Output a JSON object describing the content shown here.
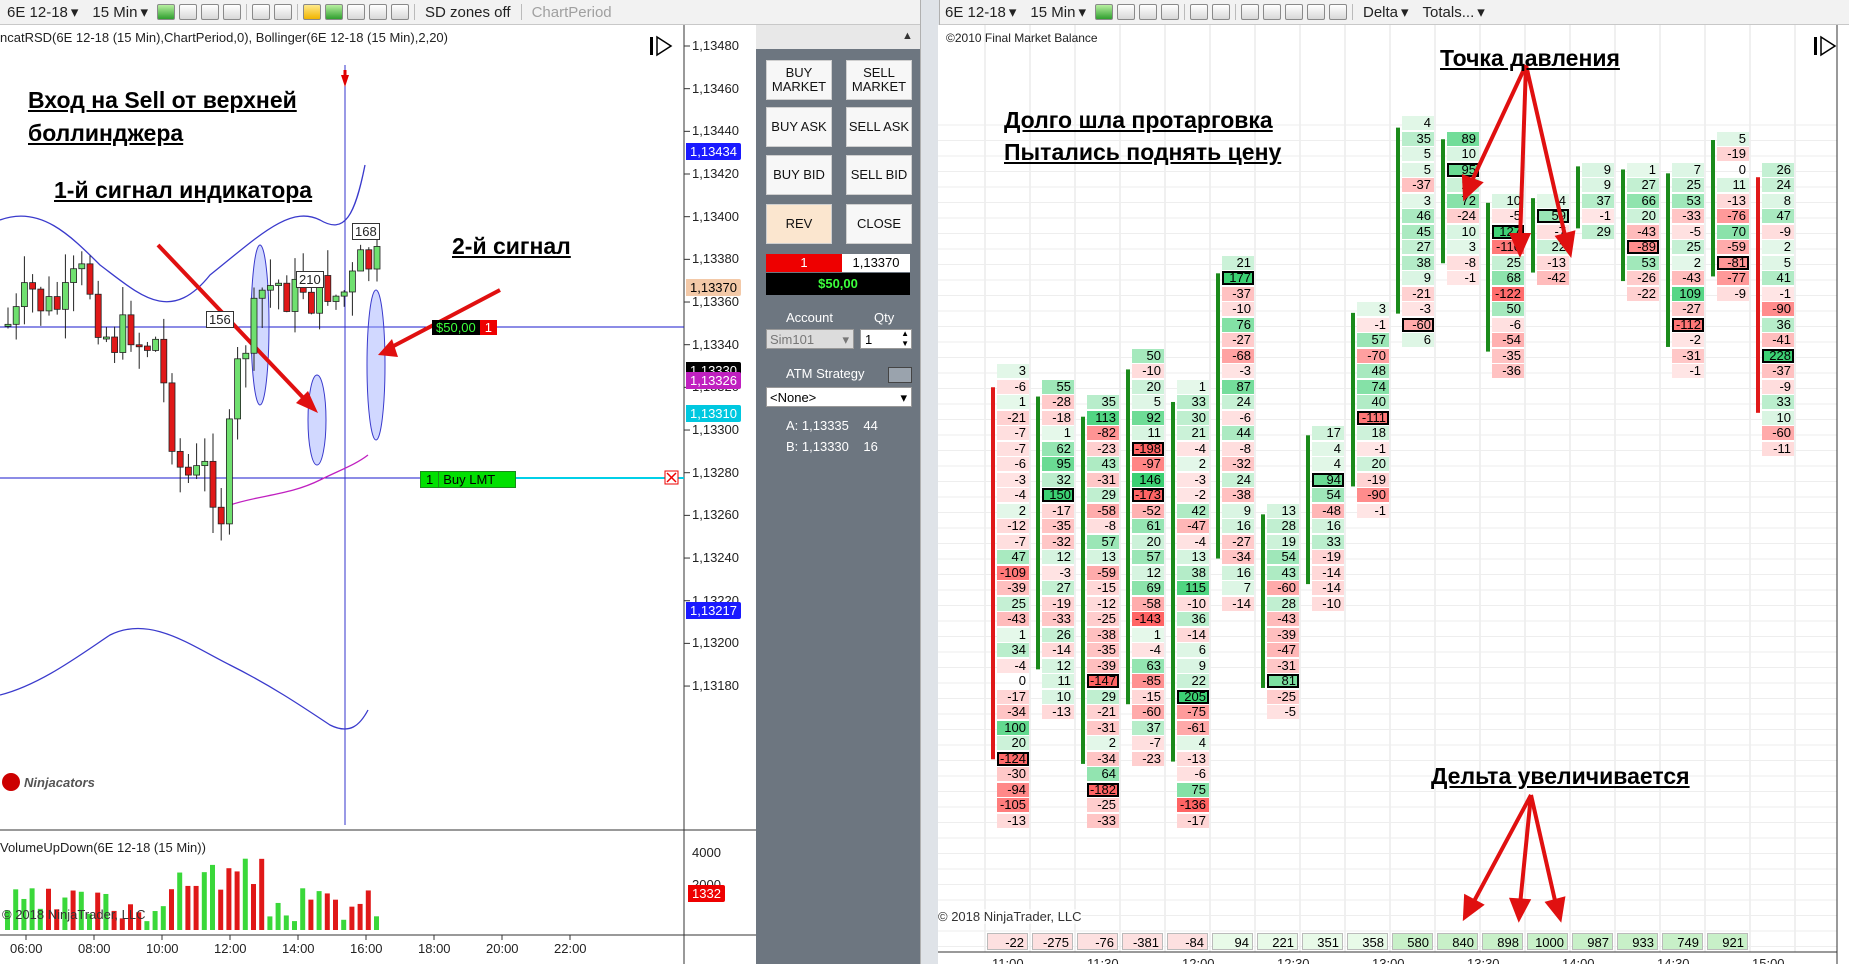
{
  "left_toolbar": {
    "instrument": "6E 12-18",
    "interval": "15 Min",
    "sd_zones": "SD zones off",
    "chart_period": "ChartPeriod"
  },
  "right_toolbar": {
    "instrument": "6E 12-18",
    "interval": "15 Min",
    "mode": "Delta",
    "totals": "Totals..."
  },
  "left_chart": {
    "indicator_label": "ncatRSD(6E 12-18 (15 Min),ChartPeriod,0), Bollinger(6E 12-18 (15 Min),2,20)",
    "price_ticks": [
      "1,13480",
      "1,13460",
      "1,13440",
      "1,13420",
      "1,13400",
      "1,13380",
      "1,13360",
      "1,13340",
      "1,13320",
      "1,13300",
      "1,13280",
      "1,13260",
      "1,13240",
      "1,13220",
      "1,13200",
      "1,13180"
    ],
    "price_flags": [
      {
        "text": "1,13434",
        "color": "#1a1aff"
      },
      {
        "text": "1,13370",
        "color": "#f3c9a8"
      },
      {
        "text": "1,13330",
        "color": "#000000"
      },
      {
        "text": "1,13326",
        "color": "#c020c0"
      },
      {
        "text": "1,13310",
        "color": "#00c8e0"
      },
      {
        "text": "1,13217",
        "color": "#1a1aff"
      }
    ],
    "candle_tags": [
      "156",
      "210",
      "168"
    ],
    "position_badge": {
      "value": "$50,00",
      "qty": "1"
    },
    "order_badge": {
      "qty": "1",
      "label": "Buy LMT"
    },
    "watermark": "Ninjacators",
    "annotations": {
      "entry_line1": "Вход на Sell от верхней",
      "entry_line2": "боллинджера",
      "signal1": "1-й сигнал индикатора",
      "signal2": "2-й сигнал"
    },
    "volume_label": "VolumeUpDown(6E 12-18 (15 Min))",
    "volume_ticks": [
      "4000",
      "2000"
    ],
    "volume_flag": "1332",
    "copyright": "© 2018 NinjaTrader, LLC",
    "time_ticks": [
      "06:00",
      "08:00",
      "10:00",
      "12:00",
      "14:00",
      "16:00",
      "18:00",
      "20:00",
      "22:00"
    ]
  },
  "order_panel": {
    "buy_market": "BUY MARKET",
    "sell_market": "SELL MARKET",
    "buy_ask": "BUY ASK",
    "sell_ask": "SELL ASK",
    "buy_bid": "BUY BID",
    "sell_bid": "SELL BID",
    "rev": "REV",
    "close": "CLOSE",
    "position_qty": "1",
    "position_price": "1,13370",
    "pnl": "$50,00",
    "account_label": "Account",
    "qty_label": "Qty",
    "account_value": "Sim101",
    "qty_value": "1",
    "atm_label": "ATM Strategy",
    "atm_value": "<None>",
    "ask_line": "A: 1,13335    44",
    "bid_line": "B: 1,13330    16"
  },
  "right_chart": {
    "header": "©2010 Final Market Balance",
    "annotations": {
      "pressure": "Точка давления",
      "line1": "Долго шла протарговка",
      "line2": "Пытались поднять цену",
      "delta": "Дельта увеличивается"
    },
    "time_ticks": [
      "11:00",
      "11:30",
      "12:00",
      "12:30",
      "13:00",
      "13:30",
      "14:00",
      "14:30",
      "15:00"
    ],
    "totals": [
      "-22",
      "-275",
      "-76",
      "-381",
      "-84",
      "94",
      "221",
      "351",
      "358",
      "580",
      "840",
      "898",
      "1000",
      "987",
      "933",
      "749",
      "921"
    ],
    "copyright": "© 2018 NinjaTrader, LLC",
    "columns": [
      {
        "start": 0,
        "values": [
          "3",
          "-6",
          "1",
          "-21",
          "-7",
          "-7",
          "-6",
          "-3",
          "-4",
          "2",
          "-12",
          "-7",
          "47",
          "-109",
          "-39",
          "25",
          "-43",
          "1",
          "34",
          "-4",
          "0",
          "-17",
          "-34",
          "100",
          "20",
          "-124",
          "-30",
          "-94",
          "-105",
          "-13"
        ],
        "boxed": [
          25
        ]
      },
      {
        "start": 1,
        "values": [
          "55",
          "-28",
          "-18",
          "1",
          "62",
          "95",
          "32",
          "150",
          "-17",
          "-35",
          "-32",
          "12",
          "-3",
          "27",
          "-19",
          "-33",
          "26",
          "-14",
          "12",
          "11",
          "10",
          "-13"
        ],
        "boxed": [
          7
        ]
      },
      {
        "start": 2,
        "values": [
          "35",
          "113",
          "-82",
          "-23",
          "43",
          "-31",
          "29",
          "-58",
          "-8",
          "57",
          "13",
          "-59",
          "-15",
          "-12",
          "-25",
          "-38",
          "-35",
          "-39",
          "-147",
          "29",
          "-21",
          "-31",
          "2",
          "-34",
          "64",
          "-182",
          "-25",
          "-33"
        ],
        "boxed": [
          18,
          25
        ]
      },
      {
        "start": -1,
        "values": [
          "50",
          "-10",
          "20",
          "5",
          "92",
          "11",
          "-198",
          "-97",
          "146",
          "-173",
          "-52",
          "61",
          "20",
          "57",
          "12",
          "69",
          "-58",
          "-143",
          "1",
          "-4",
          "63",
          "-85",
          "-15",
          "-60",
          "37",
          "-7",
          "-23"
        ],
        "boxed": [
          6,
          9
        ]
      },
      {
        "start": 1,
        "values": [
          "1",
          "33",
          "30",
          "21",
          "-4",
          "2",
          "-3",
          "-2",
          "42",
          "-47",
          "-4",
          "13",
          "38",
          "115",
          "-10",
          "36",
          "-14",
          "6",
          "9",
          "22",
          "205",
          "-75",
          "-61",
          "4",
          "-13",
          "-6",
          "75",
          "-136",
          "-17"
        ],
        "boxed": [
          20
        ]
      },
      {
        "start": -7,
        "values": [
          "21",
          "177",
          "-37",
          "-10",
          "76",
          "-27",
          "-68",
          "-3",
          "87",
          "24",
          "-6",
          "44",
          "-8",
          "-32",
          "24",
          "-38",
          "9",
          "16",
          "-27",
          "-34",
          "16",
          "7",
          "-14"
        ],
        "boxed": [
          1
        ]
      },
      {
        "start": 9,
        "values": [
          "13",
          "28",
          "19",
          "54",
          "43",
          "-60",
          "28",
          "-43",
          "-39",
          "-47",
          "-31",
          "81",
          "-25",
          "-5"
        ],
        "boxed": [
          11
        ]
      },
      {
        "start": 4,
        "values": [
          "17",
          "4",
          "4",
          "94",
          "54",
          "-48",
          "16",
          "33",
          "-19",
          "-14",
          "-14",
          "-10"
        ],
        "boxed": [
          3
        ]
      },
      {
        "start": -4,
        "values": [
          "3",
          "-1",
          "57",
          "-70",
          "48",
          "74",
          "40",
          "-111",
          "18",
          "-1",
          "20",
          "-19",
          "-90",
          "-1"
        ],
        "boxed": [
          7
        ]
      },
      {
        "start": -16,
        "values": [
          "4",
          "35",
          "5",
          "5",
          "-37",
          "3",
          "46",
          "45",
          "27",
          "38",
          "9",
          "-21",
          "-3",
          "-60",
          "6"
        ],
        "boxed": [
          13
        ]
      },
      {
        "start": -15,
        "values": [
          "89",
          "10",
          "95",
          "21",
          "72",
          "-24",
          "10",
          "3",
          "-8",
          "-1"
        ],
        "boxed": [
          2
        ]
      },
      {
        "start": -11,
        "values": [
          "10",
          "-5",
          "127",
          "-110",
          "25",
          "68",
          "-122",
          "50",
          "-6",
          "-54",
          "-35",
          "-36"
        ],
        "boxed": [
          2
        ]
      },
      {
        "start": -11,
        "values": [
          "4",
          "59",
          "-7",
          "22",
          "-13",
          "-42"
        ],
        "boxed": [
          1
        ]
      },
      {
        "start": -13,
        "values": [
          "9",
          "9",
          "37",
          "-1",
          "29"
        ],
        "boxed": []
      },
      {
        "start": -13,
        "values": [
          "1",
          "27",
          "66",
          "20",
          "-43",
          "-89",
          "53",
          "-26",
          "-22"
        ],
        "boxed": [
          5
        ]
      },
      {
        "start": -13,
        "values": [
          "7",
          "25",
          "53",
          "-33",
          "-5",
          "25",
          "2",
          "-43",
          "109",
          "-27",
          "-112",
          "-2",
          "-31",
          "-1"
        ],
        "boxed": [
          10
        ]
      },
      {
        "start": -15,
        "values": [
          "5",
          "-19",
          "0",
          "11",
          "-13",
          "-76",
          "70",
          "-59",
          "-81",
          "-77",
          "-9"
        ],
        "boxed": [
          8
        ]
      },
      {
        "start": -13,
        "values": [
          "26",
          "24",
          "8",
          "47",
          "-9",
          "2",
          "5",
          "41",
          "-1",
          "-90",
          "36",
          "-41",
          "228",
          "-37",
          "-9",
          "33",
          "10",
          "-60",
          "-11"
        ],
        "boxed": [
          12
        ]
      }
    ]
  }
}
